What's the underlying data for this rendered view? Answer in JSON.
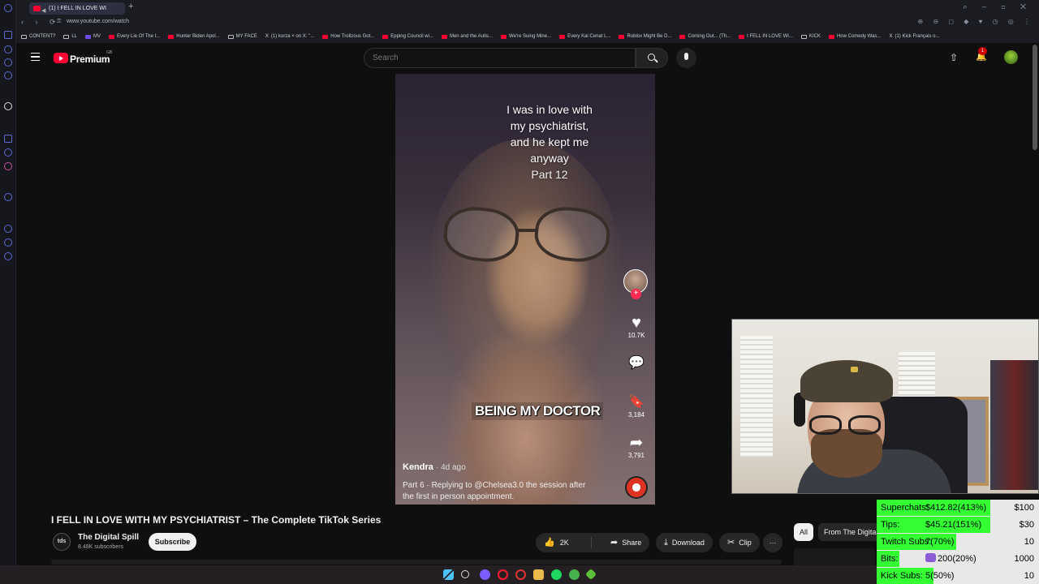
{
  "browser": {
    "tab_title": "(1) I FELL IN LOVE WI",
    "new_tab": "+",
    "url": "www.youtube.com/watch",
    "window_controls": "⌕ – ◻ ✕",
    "nav": "‹ › ⟳",
    "tools": "⊕ ⊖ ◻ ◆ ♥ ◷ ◎ ⋮"
  },
  "bookmarks": [
    {
      "label": "CONTENT?",
      "icon": "folder"
    },
    {
      "label": "LL",
      "icon": "folder"
    },
    {
      "label": "MV",
      "icon": "purple"
    },
    {
      "label": "Every Lie Of The I...",
      "icon": "youtube"
    },
    {
      "label": "Hunter Biden Apol...",
      "icon": "youtube"
    },
    {
      "label": "MY FACE",
      "icon": "folder"
    },
    {
      "label": "(1) korza × on X: \"...",
      "icon": "x"
    },
    {
      "label": "How Trollzous Got...",
      "icon": "youtube"
    },
    {
      "label": "Epping Council wi...",
      "icon": "youtube"
    },
    {
      "label": "Men and the Autis...",
      "icon": "youtube"
    },
    {
      "label": "We're Suing Mine...",
      "icon": "youtube"
    },
    {
      "label": "Every Kai Cenat L...",
      "icon": "youtube"
    },
    {
      "label": "Roblox Might Be D...",
      "icon": "youtube"
    },
    {
      "label": "Coming Out... (Th...",
      "icon": "youtube"
    },
    {
      "label": "I FELL IN LOVE WI...",
      "icon": "youtube"
    },
    {
      "label": "KICK",
      "icon": "folder"
    },
    {
      "label": "How Comedy Was...",
      "icon": "youtube"
    },
    {
      "label": "(1) Kick Français o...",
      "icon": "x"
    }
  ],
  "youtube": {
    "brand": "Premium",
    "region": "GB",
    "search_placeholder": "Search",
    "notification_count": "1",
    "upload_glyph": "⇧",
    "bell_glyph": "🔔"
  },
  "video": {
    "caption_lines": [
      "I was in love with",
      "my psychiatrist,",
      "and he kept me",
      "anyway"
    ],
    "caption_part": "Part 12",
    "subtitle": "BEING MY DOCTOR",
    "like_count": "10.7K",
    "bookmark_count": "3,184",
    "share_count": "3,791",
    "author": "Kendra",
    "age": "· 4d ago",
    "description": "Part 6 · Replying to @Chelsea3.0 the session after the first in person appointment.",
    "plus": "+",
    "glyphs": {
      "heart": "♥",
      "comment": "💬",
      "bookmark": "🔖",
      "share": "➦"
    }
  },
  "info": {
    "title": "I FELL IN LOVE WITH MY PSYCHIATRIST – The Complete TikTok Series",
    "channel_name": "The Digital Spill",
    "channel_initials": "tds",
    "subscribers": "8.48K subscribers",
    "subscribe_label": "Subscribe",
    "likes": "2K",
    "share_label": "Share",
    "download_label": "Download",
    "clip_label": "Clip",
    "more_label": "···",
    "chips": [
      "All",
      "From The Digital"
    ],
    "glyphs": {
      "like": "👍",
      "dislike": "👎",
      "share": "➦",
      "download": "⤓",
      "clip": "✂"
    }
  },
  "donations": [
    {
      "label": "Superchats:",
      "value": "$412.82(413%)",
      "goal": "$100",
      "progress": 1.0
    },
    {
      "label": "Tips:",
      "value": "$45.21(151%)",
      "goal": "$30",
      "progress": 1.0
    },
    {
      "label": "Twitch Subs:",
      "value": "7(70%)",
      "goal": "10",
      "progress": 0.7
    },
    {
      "label": "Bits:",
      "value": "200(20%)",
      "goal": "1000",
      "progress": 0.2
    },
    {
      "label": "Kick Subs:",
      "value": "5(50%)",
      "goal": "10",
      "progress": 0.5
    }
  ]
}
